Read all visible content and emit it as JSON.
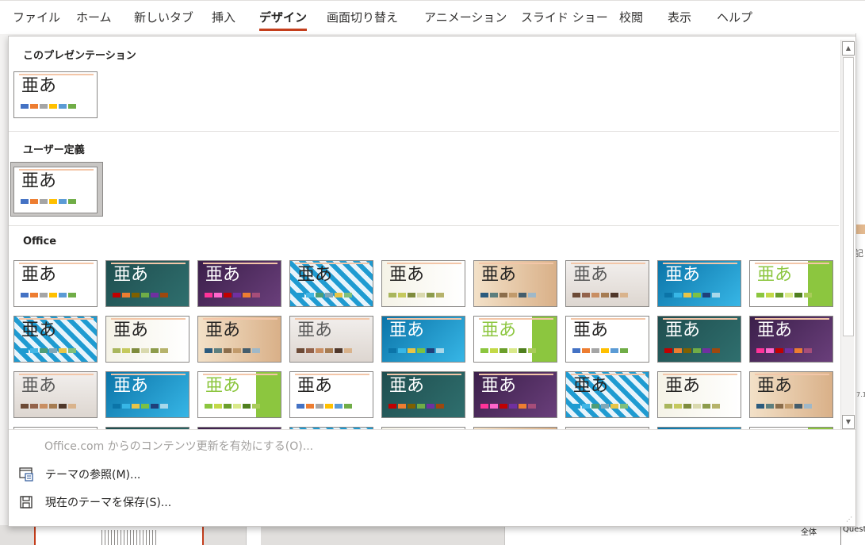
{
  "ribbon": {
    "tabs": [
      "ファイル",
      "ホーム",
      "新しいタブ",
      "挿入",
      "デザイン",
      "画面切り替え",
      "アニメーション",
      "スライド ショー",
      "校閲",
      "表示",
      "ヘルプ"
    ],
    "active_tab": "デザイン"
  },
  "gallery": {
    "sections": {
      "this_presentation": "このプレゼンテーション",
      "user_defined": "ユーザー定義",
      "office": "Office"
    },
    "thumb_text": "亜あ"
  },
  "menu": {
    "enable_updates": "Office.com からのコンテンツ更新を有効にする(O)...",
    "browse_themes": "テーマの参照(M)...",
    "save_theme": "現在のテーマを保存(S)..."
  },
  "background": {
    "right_bottom_left": "全体",
    "right_bottom_right": "Quest",
    "right_edge_text": "記",
    "right_edge_num": "7.1"
  },
  "colors": {
    "accent_tab_underline": "#c43e1c",
    "office_palette": [
      "#4472c4",
      "#ed7d31",
      "#a5a5a5",
      "#ffc000",
      "#5b9bd5",
      "#70ad47"
    ]
  }
}
